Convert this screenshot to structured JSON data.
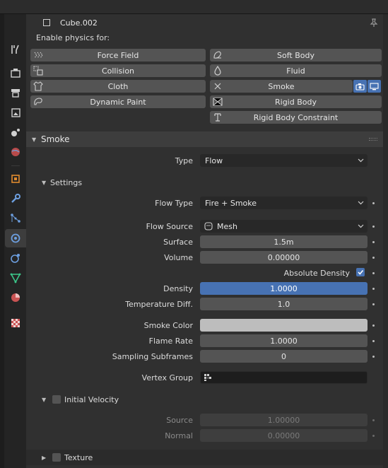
{
  "header": {
    "object_name": "Cube.002"
  },
  "physics": {
    "enable_label": "Enable physics for:",
    "buttons": {
      "force_field": "Force Field",
      "soft_body": "Soft Body",
      "collision": "Collision",
      "fluid": "Fluid",
      "cloth": "Cloth",
      "smoke": "Smoke",
      "dynamic_paint": "Dynamic Paint",
      "rigid_body": "Rigid Body",
      "rigid_body_constraint": "Rigid Body Constraint"
    }
  },
  "smoke_panel": {
    "title": "Smoke",
    "type_label": "Type",
    "type_value": "Flow",
    "settings": {
      "title": "Settings",
      "flow_type_label": "Flow Type",
      "flow_type_value": "Fire + Smoke",
      "flow_source_label": "Flow Source",
      "flow_source_value": "Mesh",
      "surface_label": "Surface",
      "surface_value": "1.5m",
      "volume_label": "Volume",
      "volume_value": "0.00000",
      "absolute_density_label": "Absolute Density",
      "absolute_density_checked": true,
      "density_label": "Density",
      "density_value": "1.0000",
      "temperature_label": "Temperature Diff.",
      "temperature_value": "1.0",
      "smoke_color_label": "Smoke Color",
      "smoke_color_value": "#bdbdbd",
      "flame_rate_label": "Flame Rate",
      "flame_rate_value": "1.0000",
      "subframes_label": "Sampling Subframes",
      "subframes_value": "0",
      "vertex_group_label": "Vertex Group"
    },
    "initial_velocity": {
      "title": "Initial Velocity",
      "checked": false,
      "source_label": "Source",
      "source_value": "1.00000",
      "normal_label": "Normal",
      "normal_value": "0.00000"
    },
    "texture": {
      "title": "Texture",
      "checked": false
    }
  },
  "colors": {
    "accent": "#4772b3",
    "panel": "#303030",
    "button": "#545454"
  }
}
